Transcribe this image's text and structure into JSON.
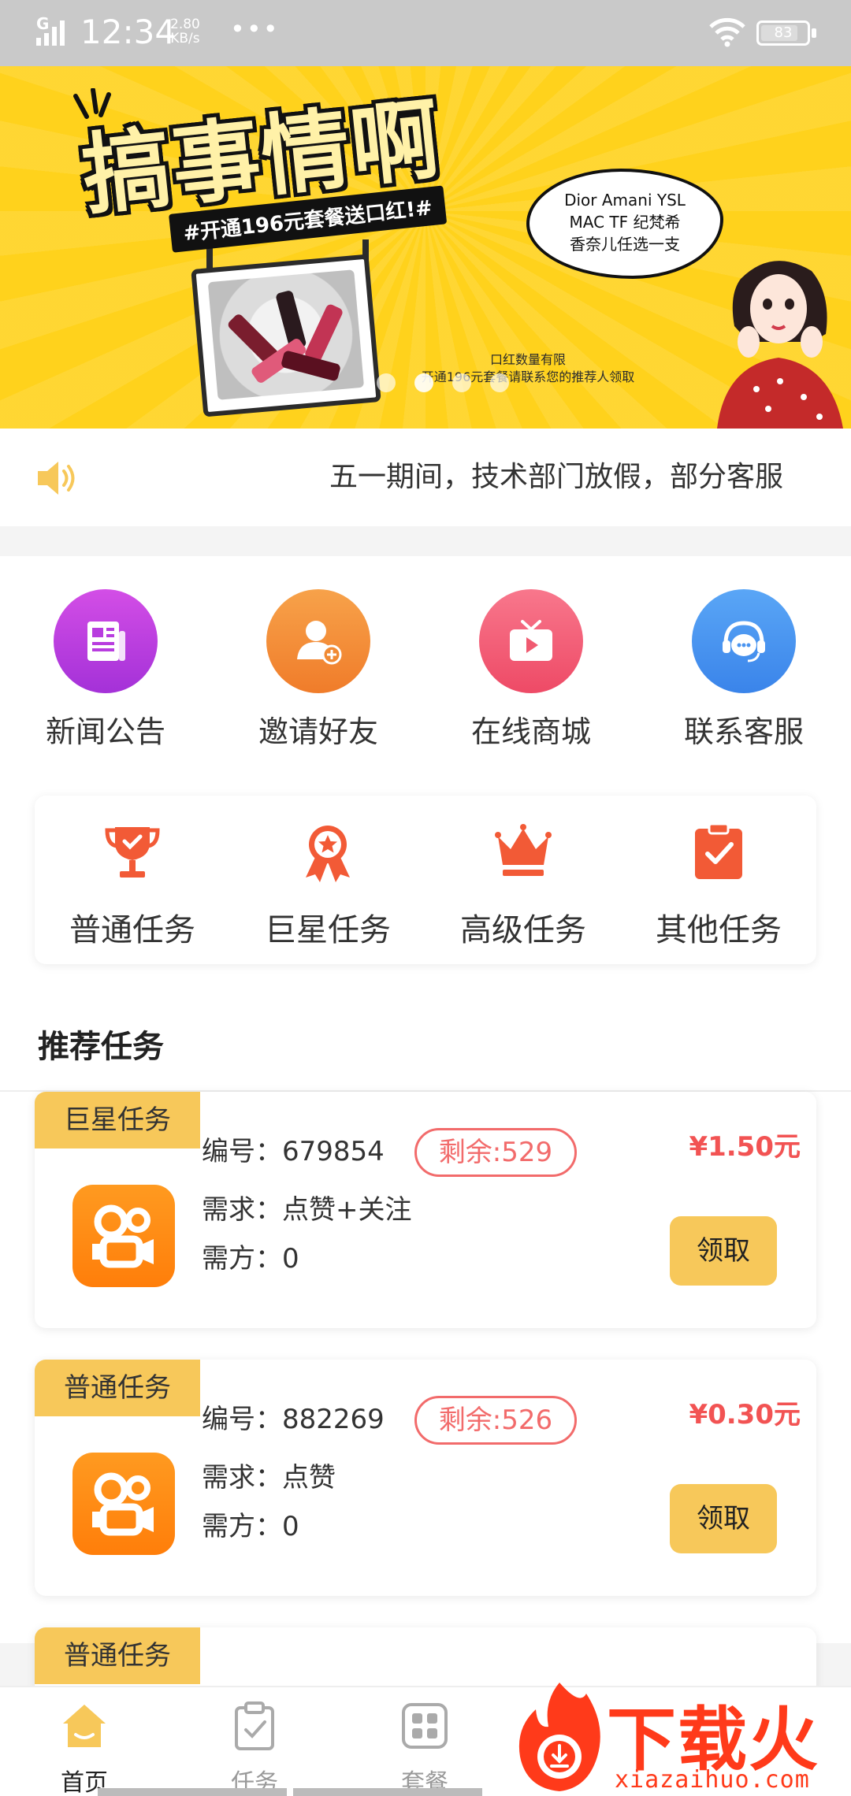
{
  "status_bar": {
    "network": "G",
    "time": "12:34",
    "speed_value": "2.80",
    "speed_unit": "KB/s",
    "more": "•••",
    "battery": "83"
  },
  "banner": {
    "title": "搞事情啊",
    "tag": "#开通196元套餐送口红!#",
    "bubble_line1": "Dior Amani YSL",
    "bubble_line2": "MAC TF 纪梵希",
    "bubble_line3": "香奈儿任选一支",
    "limit_line1": "口红数量有限",
    "limit_line2": "开通196元套餐请联系您的推荐人领取",
    "slides": 4,
    "active_slide": 1
  },
  "notice": {
    "icon": "speaker-icon",
    "text": "五一期间，技术部门放假，部分客服"
  },
  "quick_links": [
    {
      "label": "新闻公告",
      "icon": "news-icon",
      "color_from": "#d34ee6",
      "color_to": "#a431d8"
    },
    {
      "label": "邀请好友",
      "icon": "add-user-icon",
      "color_from": "#f7a24a",
      "color_to": "#f07c2a"
    },
    {
      "label": "在线商城",
      "icon": "tv-play-icon",
      "color_from": "#f8778c",
      "color_to": "#ee4a66"
    },
    {
      "label": "联系客服",
      "icon": "headset-icon",
      "color_from": "#5aa6f6",
      "color_to": "#3a84ea"
    }
  ],
  "task_categories": [
    {
      "label": "普通任务",
      "icon": "trophy-icon"
    },
    {
      "label": "巨星任务",
      "icon": "medal-icon"
    },
    {
      "label": "高级任务",
      "icon": "crown-icon"
    },
    {
      "label": "其他任务",
      "icon": "clipboard-check-icon"
    }
  ],
  "recommend_title": "推荐任务",
  "labels": {
    "id": "编号：",
    "demand": "需求：",
    "party": "需方：",
    "claim": "领取"
  },
  "tasks": [
    {
      "tag": "巨星任务",
      "id": "679854",
      "remaining": "剩余:529",
      "demand": "点赞+关注",
      "party": "0",
      "price": "¥1.50元"
    },
    {
      "tag": "普通任务",
      "id": "882269",
      "remaining": "剩余:526",
      "demand": "点赞",
      "party": "0",
      "price": "¥0.30元"
    },
    {
      "tag": "普通任务",
      "id": "",
      "remaining": "",
      "demand": "",
      "party": "",
      "price": ""
    }
  ],
  "bottom_nav": [
    {
      "label": "首页",
      "icon": "home-icon",
      "active": true
    },
    {
      "label": "任务",
      "icon": "clipboard-icon",
      "active": false
    },
    {
      "label": "套餐",
      "icon": "grid-icon",
      "active": false
    }
  ],
  "watermark": {
    "title": "下载火",
    "url": "xiazaihuo.com"
  },
  "colors": {
    "accent": "#f7c85a",
    "price": "#f25353",
    "banner": "#ffd21c"
  }
}
